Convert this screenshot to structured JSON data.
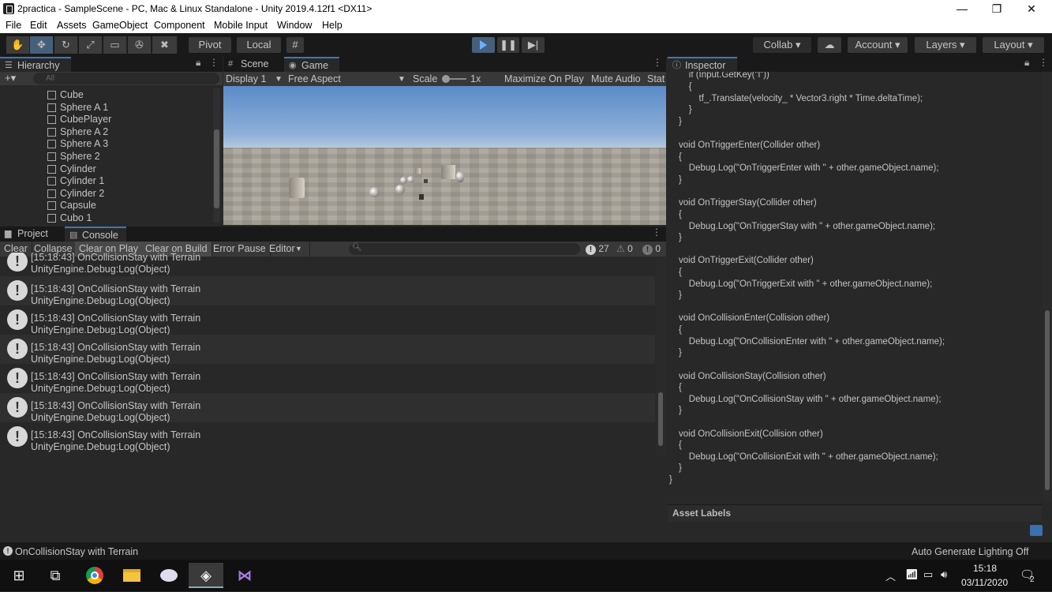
{
  "title_bar": {
    "title": "2practica - SampleScene - PC, Mac & Linux Standalone - Unity 2019.4.12f1 <DX11>",
    "minimize": "—",
    "restore": "❐",
    "close": "✕"
  },
  "menu": [
    "File",
    "Edit",
    "Assets",
    "GameObject",
    "Component",
    "Mobile Input",
    "Window",
    "Help"
  ],
  "toolbar": {
    "pivot": "Pivot",
    "local": "Local",
    "collab": "Collab",
    "account": "Account",
    "layers": "Layers",
    "layout": "Layout",
    "play_icon": "play-icon",
    "pause_icon": "pause-icon",
    "step_icon": "step-icon"
  },
  "hierarchy": {
    "tab": "Hierarchy",
    "search_placeholder": "All",
    "items": [
      "Cube",
      "Sphere A 1",
      "CubePlayer",
      "Sphere A 2",
      "Sphere A 3",
      "Sphere 2",
      "Cylinder",
      "Cylinder 1",
      "Cylinder 2",
      "Capsule",
      "Cubo 1"
    ]
  },
  "game": {
    "tab_scene": "Scene",
    "tab_game": "Game",
    "display": "Display 1",
    "aspect": "Free Aspect",
    "scale_label": "Scale",
    "scale_value": "1x",
    "maximize": "Maximize On Play",
    "mute": "Mute Audio",
    "stats": "Stat"
  },
  "console": {
    "tab_project": "Project",
    "tab_console": "Console",
    "clear": "Clear",
    "collapse": "Collapse",
    "clear_on_play": "Clear on Play",
    "clear_on_build": "Clear on Build",
    "error_pause": "Error Pause",
    "editor": "Editor",
    "count_info": "27",
    "count_warn": "0",
    "count_error": "0",
    "logs": [
      {
        "line1": "[15:18:43] OnCollisionStay with Terrain",
        "line2": "UnityEngine.Debug:Log(Object)"
      },
      {
        "line1": "[15:18:43] OnCollisionStay with Terrain",
        "line2": "UnityEngine.Debug:Log(Object)"
      },
      {
        "line1": "[15:18:43] OnCollisionStay with Terrain",
        "line2": "UnityEngine.Debug:Log(Object)"
      },
      {
        "line1": "[15:18:43] OnCollisionStay with Terrain",
        "line2": "UnityEngine.Debug:Log(Object)"
      },
      {
        "line1": "[15:18:43] OnCollisionStay with Terrain",
        "line2": "UnityEngine.Debug:Log(Object)"
      },
      {
        "line1": "[15:18:43] OnCollisionStay with Terrain",
        "line2": "UnityEngine.Debug:Log(Object)"
      },
      {
        "line1": "[15:18:43] OnCollisionStay with Terrain",
        "line2": "UnityEngine.Debug:Log(Object)"
      }
    ]
  },
  "inspector": {
    "tab": "Inspector",
    "code_lines": [
      "    if (Input.GetKey(\"l\"))",
      "    {",
      "        tf_.Translate(velocity_ * Vector3.right * Time.deltaTime);",
      "    }",
      "}",
      "",
      "void OnTriggerEnter(Collider other)",
      "{",
      "    Debug.Log(\"OnTriggerEnter with \" + other.gameObject.name);",
      "}",
      "",
      "void OnTriggerStay(Collider other)",
      "{",
      "    Debug.Log(\"OnTriggerStay with \" + other.gameObject.name);",
      "}",
      "",
      "void OnTriggerExit(Collider other)",
      "{",
      "    Debug.Log(\"OnTriggerExit with \" + other.gameObject.name);",
      "}",
      "",
      "void OnCollisionEnter(Collision other)",
      "{",
      "    Debug.Log(\"OnCollisionEnter with \" + other.gameObject.name);",
      "}",
      "",
      "void OnCollisionStay(Collision other)",
      "{",
      "    Debug.Log(\"OnCollisionStay with \" + other.gameObject.name);",
      "}",
      "",
      "void OnCollisionExit(Collision other)",
      "{",
      "    Debug.Log(\"OnCollisionExit with \" + other.gameObject.name);",
      "}",
      "}"
    ],
    "asset_labels": "Asset Labels"
  },
  "status": {
    "message": "OnCollisionStay with Terrain",
    "lighting": "Auto Generate Lighting Off"
  },
  "taskbar": {
    "time": "15:18",
    "date": "03/11/2020",
    "notifications": "2"
  }
}
